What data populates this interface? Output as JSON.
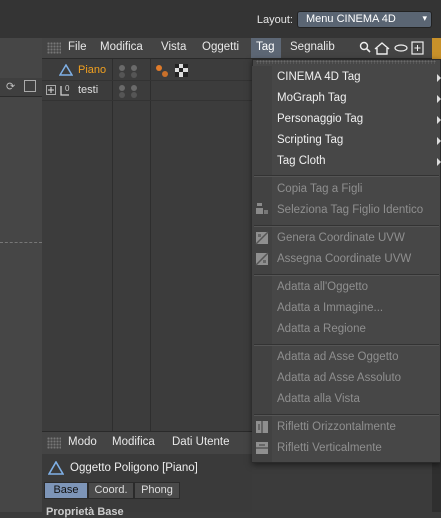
{
  "layout": {
    "label": "Layout:",
    "value": "Menu CINEMA 4D"
  },
  "menubar": {
    "file": "File",
    "edit": "Modifica",
    "view": "Vista",
    "objects": "Oggetti",
    "tag": "Tag",
    "bookmarks": "Segnalib"
  },
  "objects": [
    {
      "name": "Piano",
      "color": "#f0a020"
    },
    {
      "name": "testi",
      "color": "#e0e0e0"
    }
  ],
  "attributes": {
    "menu": {
      "mode": "Modo",
      "edit": "Modifica",
      "user_data": "Dati Utente"
    },
    "title": "Oggetto Poligono [Piano]",
    "tabs": [
      "Base",
      "Coord.",
      "Phong"
    ],
    "section": "Proprietà Base"
  },
  "tag_menu": {
    "group1": [
      "CINEMA 4D Tag",
      "MoGraph Tag",
      "Personaggio Tag",
      "Scripting Tag",
      "Tag Cloth"
    ],
    "group2": [
      "Copia Tag a Figli",
      "Seleziona Tag Figlio Identico"
    ],
    "group3": [
      "Genera Coordinate UVW",
      "Assegna Coordinate UVW"
    ],
    "group4": [
      "Adatta all'Oggetto",
      "Adatta a Immagine...",
      "Adatta a Regione"
    ],
    "group5": [
      "Adatta ad Asse Oggetto",
      "Adatta ad Asse Assoluto",
      "Adatta alla Vista"
    ],
    "group6": [
      "Rifletti Orizzontalmente",
      "Rifletti Verticalmente"
    ]
  },
  "colors": {
    "accent": "#5d6775",
    "selected_object": "#f0a020",
    "background": "#3b3b3b"
  }
}
